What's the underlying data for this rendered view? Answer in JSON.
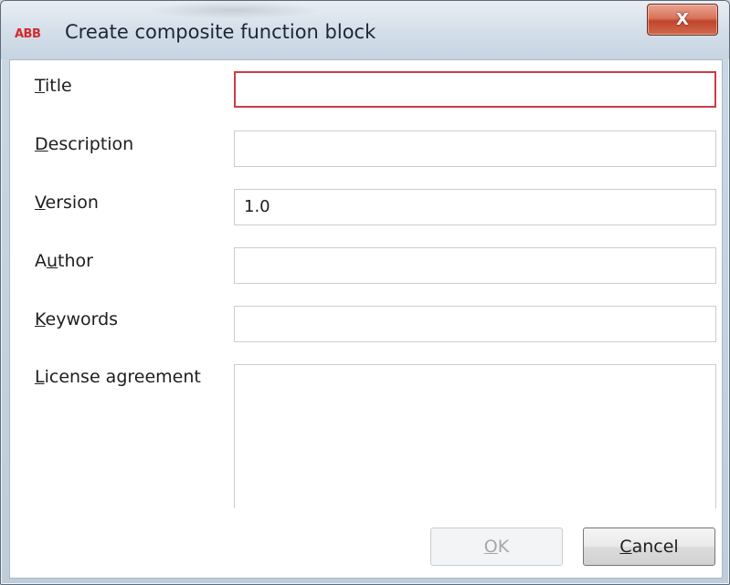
{
  "window": {
    "logo_text": "ABB",
    "title": "Create composite function block",
    "close_glyph": "X",
    "brand_color": "#d42b2b"
  },
  "form": {
    "fields": [
      {
        "mnemonic": "T",
        "rest": "itle",
        "value": "",
        "state": "error"
      },
      {
        "mnemonic": "D",
        "rest": "escription",
        "value": ""
      },
      {
        "mnemonic": "V",
        "rest": "ersion",
        "value": "1.0"
      },
      {
        "prefix": "A",
        "mnemonic": "u",
        "rest": "thor",
        "value": ""
      },
      {
        "mnemonic": "K",
        "rest": "eywords",
        "value": ""
      },
      {
        "mnemonic": "L",
        "rest": "icense agreement",
        "value": ""
      }
    ],
    "error_color": "#cf3b48"
  },
  "buttons": {
    "ok": {
      "mnemonic": "O",
      "rest": "K",
      "enabled": false
    },
    "cancel": {
      "mnemonic": "C",
      "rest": "ancel",
      "enabled": true
    }
  }
}
